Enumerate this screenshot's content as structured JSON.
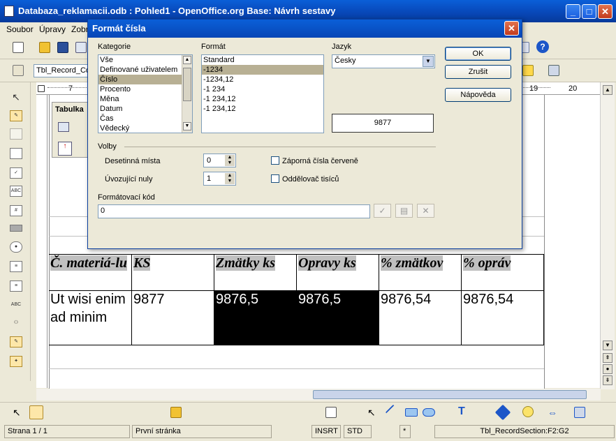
{
  "window": {
    "title": "Databaza_reklamacii.odb : Pohled1 - OpenOffice.org Base: Návrh sestavy",
    "minimize": "_",
    "maximize": "□",
    "close": "✕"
  },
  "menubar": [
    "Soubor",
    "Úpravy",
    "Zobr"
  ],
  "toolbar2": {
    "object_select": "Tbl_Record_Co"
  },
  "ruler": {
    "left_mark": "7",
    "right_marks": [
      "19",
      "20"
    ]
  },
  "doc": {
    "tab_label": "Tabulka",
    "headers": [
      "Č. materiá-lu",
      "KS",
      "Zmätky ks",
      "Opravy ks",
      "% zmätkov",
      "% opráv"
    ],
    "row": [
      "Ut wisi enim ad minim",
      "9877",
      "9876,5",
      "9876,5",
      "9876,54",
      "9876,54"
    ]
  },
  "dialog": {
    "title": "Formát čísla",
    "close": "✕",
    "category_label": "Kategorie",
    "categories": [
      "Vše",
      "Definované uživatelem",
      "Číslo",
      "Procento",
      "Měna",
      "Datum",
      "Čas",
      "Vědecký"
    ],
    "category_selected": 2,
    "format_label": "Formát",
    "formats": [
      "Standard",
      "-1234",
      "-1234,12",
      "-1 234",
      "-1 234,12",
      "-1 234,12"
    ],
    "format_selected": 1,
    "language_label": "Jazyk",
    "language_value": "Česky",
    "preview": "9877",
    "options_label": "Volby",
    "decimal_label": "Desetinná místa",
    "decimal_value": "0",
    "leading_label": "Úvozující nuly",
    "leading_value": "1",
    "negative_red_label": "Záporná čísla červeně",
    "thousands_label": "Oddělovač tisíců",
    "format_code_label": "Formátovací kód",
    "format_code_value": "0",
    "ok": "OK",
    "cancel": "Zrušit",
    "help": "Nápověda"
  },
  "status": {
    "page": "Strana 1 / 1",
    "page_style": "První stránka",
    "insert_mode": "INSRT",
    "selection_mode": "STD",
    "modified": "*",
    "section": "Tbl_RecordSection:F2:G2"
  }
}
